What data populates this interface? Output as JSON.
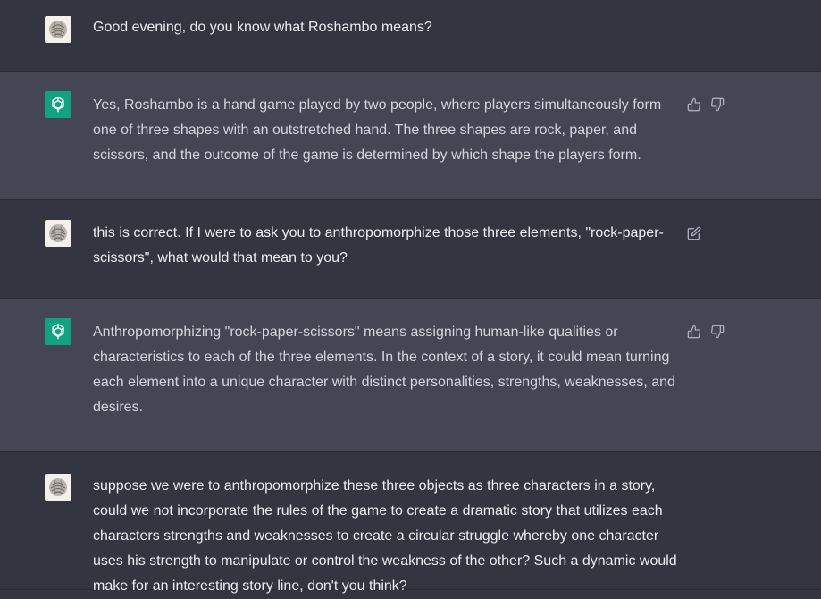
{
  "messages": [
    {
      "role": "user",
      "text": "Good evening, do you know what Roshambo means?"
    },
    {
      "role": "assistant",
      "text": "Yes, Roshambo is a hand game played by two people, where players simultaneously form one of three shapes with an outstretched hand. The three shapes are rock, paper, and scissors, and the outcome of the game is determined by which shape the players form."
    },
    {
      "role": "user",
      "text": "this is correct. If I were to ask you to anthropomorphize those three elements, \"rock-paper-scissors\", what would that mean to you?"
    },
    {
      "role": "assistant",
      "text": "Anthropomorphizing \"rock-paper-scissors\" means assigning human-like qualities or characteristics to each of the three elements. In the context of a story, it could mean turning each element into a unique character with distinct personalities, strengths, weaknesses, and desires."
    },
    {
      "role": "user",
      "text": "suppose we were to anthropomorphize these three objects as three characters in a story, could we not incorporate the rules of the game to create a dramatic story that utilizes each characters strengths and weaknesses to create a circular struggle whereby one character uses his strength to manipulate or control the weakness of the other? Such a dynamic would make for an interesting story line, don't you think?"
    }
  ],
  "icons": {
    "user_avatar": "user-avatar-icon",
    "assistant_avatar": "openai-logo-icon",
    "like": "thumbs-up-icon",
    "dislike": "thumbs-down-icon",
    "edit": "edit-icon"
  },
  "colors": {
    "user_bg": "#343541",
    "assistant_bg": "#444654",
    "assistant_avatar_bg": "#10a37f",
    "icon": "#acacbe"
  }
}
